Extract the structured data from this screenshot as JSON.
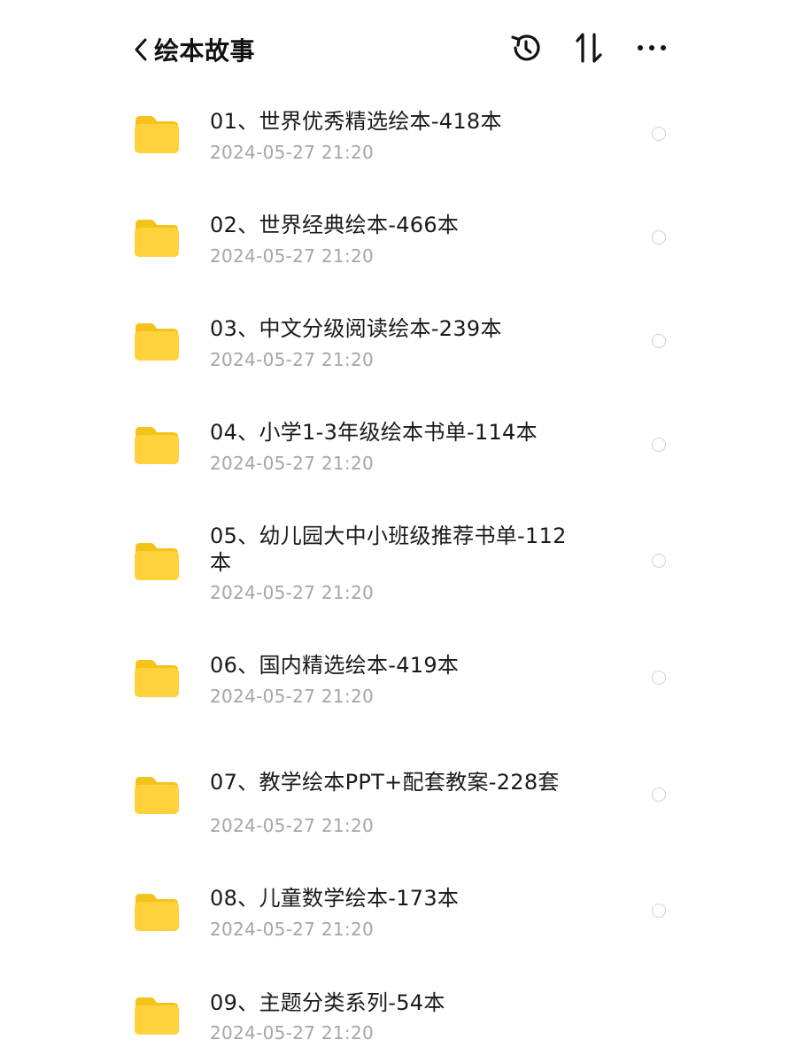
{
  "header": {
    "title": "绘本故事",
    "back_icon": "chevron-left-icon",
    "history_icon": "history-icon",
    "sort_icon": "sort-icon",
    "more_icon": "more-icon"
  },
  "colors": {
    "folder": "#FFD23C",
    "folder_tab": "#F5C21A",
    "date_text": "#A3A6AD"
  },
  "files": [
    {
      "name": "01、世界优秀精选绘本-418本",
      "date": "2024-05-27 21:20",
      "icon": "folder-icon"
    },
    {
      "name": "02、世界经典绘本-466本",
      "date": "2024-05-27 21:20",
      "icon": "folder-icon"
    },
    {
      "name": "03、中文分级阅读绘本-239本",
      "date": "2024-05-27 21:20",
      "icon": "folder-icon"
    },
    {
      "name": "04、小学1-3年级绘本书单-114本",
      "date": "2024-05-27 21:20",
      "icon": "folder-icon"
    },
    {
      "name": "05、幼儿园大中小班级推荐书单-112本",
      "date": "2024-05-27 21:20",
      "icon": "folder-icon"
    },
    {
      "name": "06、国内精选绘本-419本",
      "date": "2024-05-27 21:20",
      "icon": "folder-icon"
    },
    {
      "name": "07、教学绘本PPT+配套教案-228套",
      "date": "2024-05-27 21:20",
      "icon": "folder-icon"
    },
    {
      "name": "08、儿童数学绘本-173本",
      "date": "2024-05-27 21:20",
      "icon": "folder-icon"
    },
    {
      "name": "09、主题分类系列-54本",
      "date": "2024-05-27 21:20",
      "icon": "folder-icon"
    }
  ]
}
